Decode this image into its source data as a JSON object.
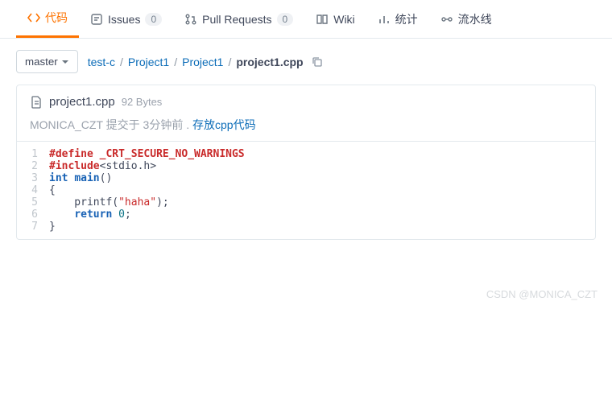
{
  "tabs": {
    "code": "代码",
    "issues": "Issues",
    "issues_count": "0",
    "pulls": "Pull Requests",
    "pulls_count": "0",
    "wiki": "Wiki",
    "stats": "统计",
    "pipeline": "流水线"
  },
  "branch": {
    "name": "master"
  },
  "breadcrumb": {
    "root": "test-c",
    "p1": "Project1",
    "p2": "Project1",
    "file": "project1.cpp"
  },
  "file": {
    "name": "project1.cpp",
    "size": "92 Bytes",
    "author": "MONICA_CZT",
    "commit_prefix": "提交于",
    "commit_time": "3分钟前",
    "commit_dot": ".",
    "commit_msg": "存放cpp代码"
  },
  "code": {
    "l1_kw": "#define",
    "l1_rest": " _CRT_SECURE_NO_WARNINGS",
    "l2_kw": "#include",
    "l2_rest": "<stdio.h>",
    "l3_kw1": "int",
    "l3_kw2": "main",
    "l3_rest": "()",
    "l4": "{",
    "l5_pre": "    printf(",
    "l5_str": "\"haha\"",
    "l5_post": ");",
    "l6_pre": "    ",
    "l6_kw": "return",
    "l6_sp": " ",
    "l6_num": "0",
    "l6_post": ";",
    "l7": "}"
  },
  "lines": {
    "1": "1",
    "2": "2",
    "3": "3",
    "4": "4",
    "5": "5",
    "6": "6",
    "7": "7"
  },
  "watermark": "CSDN @MONICA_CZT"
}
